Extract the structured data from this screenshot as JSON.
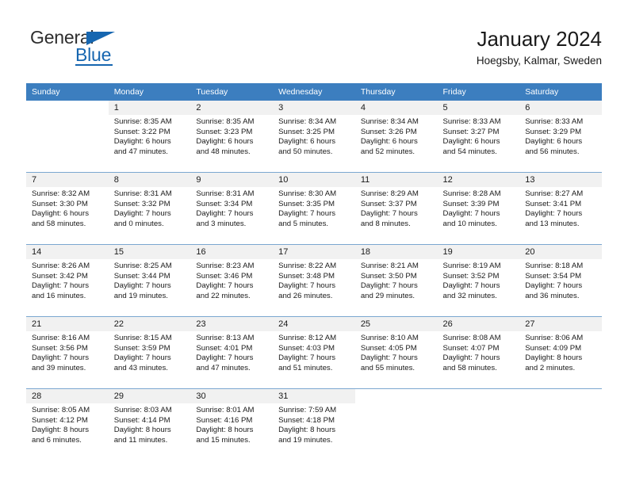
{
  "brand": {
    "name_part1": "General",
    "name_part2": "Blue",
    "accent_color": "#1666b0"
  },
  "header": {
    "title": "January 2024",
    "subtitle": "Hoegsby, Kalmar, Sweden"
  },
  "calendar": {
    "header_bg": "#3c7ebf",
    "daynum_bg": "#f1f1f1",
    "weekday_headers": [
      "Sunday",
      "Monday",
      "Tuesday",
      "Wednesday",
      "Thursday",
      "Friday",
      "Saturday"
    ],
    "weeks": [
      [
        {
          "day": "",
          "lines": []
        },
        {
          "day": "1",
          "lines": [
            "Sunrise: 8:35 AM",
            "Sunset: 3:22 PM",
            "Daylight: 6 hours",
            "and 47 minutes."
          ]
        },
        {
          "day": "2",
          "lines": [
            "Sunrise: 8:35 AM",
            "Sunset: 3:23 PM",
            "Daylight: 6 hours",
            "and 48 minutes."
          ]
        },
        {
          "day": "3",
          "lines": [
            "Sunrise: 8:34 AM",
            "Sunset: 3:25 PM",
            "Daylight: 6 hours",
            "and 50 minutes."
          ]
        },
        {
          "day": "4",
          "lines": [
            "Sunrise: 8:34 AM",
            "Sunset: 3:26 PM",
            "Daylight: 6 hours",
            "and 52 minutes."
          ]
        },
        {
          "day": "5",
          "lines": [
            "Sunrise: 8:33 AM",
            "Sunset: 3:27 PM",
            "Daylight: 6 hours",
            "and 54 minutes."
          ]
        },
        {
          "day": "6",
          "lines": [
            "Sunrise: 8:33 AM",
            "Sunset: 3:29 PM",
            "Daylight: 6 hours",
            "and 56 minutes."
          ]
        }
      ],
      [
        {
          "day": "7",
          "lines": [
            "Sunrise: 8:32 AM",
            "Sunset: 3:30 PM",
            "Daylight: 6 hours",
            "and 58 minutes."
          ]
        },
        {
          "day": "8",
          "lines": [
            "Sunrise: 8:31 AM",
            "Sunset: 3:32 PM",
            "Daylight: 7 hours",
            "and 0 minutes."
          ]
        },
        {
          "day": "9",
          "lines": [
            "Sunrise: 8:31 AM",
            "Sunset: 3:34 PM",
            "Daylight: 7 hours",
            "and 3 minutes."
          ]
        },
        {
          "day": "10",
          "lines": [
            "Sunrise: 8:30 AM",
            "Sunset: 3:35 PM",
            "Daylight: 7 hours",
            "and 5 minutes."
          ]
        },
        {
          "day": "11",
          "lines": [
            "Sunrise: 8:29 AM",
            "Sunset: 3:37 PM",
            "Daylight: 7 hours",
            "and 8 minutes."
          ]
        },
        {
          "day": "12",
          "lines": [
            "Sunrise: 8:28 AM",
            "Sunset: 3:39 PM",
            "Daylight: 7 hours",
            "and 10 minutes."
          ]
        },
        {
          "day": "13",
          "lines": [
            "Sunrise: 8:27 AM",
            "Sunset: 3:41 PM",
            "Daylight: 7 hours",
            "and 13 minutes."
          ]
        }
      ],
      [
        {
          "day": "14",
          "lines": [
            "Sunrise: 8:26 AM",
            "Sunset: 3:42 PM",
            "Daylight: 7 hours",
            "and 16 minutes."
          ]
        },
        {
          "day": "15",
          "lines": [
            "Sunrise: 8:25 AM",
            "Sunset: 3:44 PM",
            "Daylight: 7 hours",
            "and 19 minutes."
          ]
        },
        {
          "day": "16",
          "lines": [
            "Sunrise: 8:23 AM",
            "Sunset: 3:46 PM",
            "Daylight: 7 hours",
            "and 22 minutes."
          ]
        },
        {
          "day": "17",
          "lines": [
            "Sunrise: 8:22 AM",
            "Sunset: 3:48 PM",
            "Daylight: 7 hours",
            "and 26 minutes."
          ]
        },
        {
          "day": "18",
          "lines": [
            "Sunrise: 8:21 AM",
            "Sunset: 3:50 PM",
            "Daylight: 7 hours",
            "and 29 minutes."
          ]
        },
        {
          "day": "19",
          "lines": [
            "Sunrise: 8:19 AM",
            "Sunset: 3:52 PM",
            "Daylight: 7 hours",
            "and 32 minutes."
          ]
        },
        {
          "day": "20",
          "lines": [
            "Sunrise: 8:18 AM",
            "Sunset: 3:54 PM",
            "Daylight: 7 hours",
            "and 36 minutes."
          ]
        }
      ],
      [
        {
          "day": "21",
          "lines": [
            "Sunrise: 8:16 AM",
            "Sunset: 3:56 PM",
            "Daylight: 7 hours",
            "and 39 minutes."
          ]
        },
        {
          "day": "22",
          "lines": [
            "Sunrise: 8:15 AM",
            "Sunset: 3:59 PM",
            "Daylight: 7 hours",
            "and 43 minutes."
          ]
        },
        {
          "day": "23",
          "lines": [
            "Sunrise: 8:13 AM",
            "Sunset: 4:01 PM",
            "Daylight: 7 hours",
            "and 47 minutes."
          ]
        },
        {
          "day": "24",
          "lines": [
            "Sunrise: 8:12 AM",
            "Sunset: 4:03 PM",
            "Daylight: 7 hours",
            "and 51 minutes."
          ]
        },
        {
          "day": "25",
          "lines": [
            "Sunrise: 8:10 AM",
            "Sunset: 4:05 PM",
            "Daylight: 7 hours",
            "and 55 minutes."
          ]
        },
        {
          "day": "26",
          "lines": [
            "Sunrise: 8:08 AM",
            "Sunset: 4:07 PM",
            "Daylight: 7 hours",
            "and 58 minutes."
          ]
        },
        {
          "day": "27",
          "lines": [
            "Sunrise: 8:06 AM",
            "Sunset: 4:09 PM",
            "Daylight: 8 hours",
            "and 2 minutes."
          ]
        }
      ],
      [
        {
          "day": "28",
          "lines": [
            "Sunrise: 8:05 AM",
            "Sunset: 4:12 PM",
            "Daylight: 8 hours",
            "and 6 minutes."
          ]
        },
        {
          "day": "29",
          "lines": [
            "Sunrise: 8:03 AM",
            "Sunset: 4:14 PM",
            "Daylight: 8 hours",
            "and 11 minutes."
          ]
        },
        {
          "day": "30",
          "lines": [
            "Sunrise: 8:01 AM",
            "Sunset: 4:16 PM",
            "Daylight: 8 hours",
            "and 15 minutes."
          ]
        },
        {
          "day": "31",
          "lines": [
            "Sunrise: 7:59 AM",
            "Sunset: 4:18 PM",
            "Daylight: 8 hours",
            "and 19 minutes."
          ]
        },
        {
          "day": "",
          "lines": []
        },
        {
          "day": "",
          "lines": []
        },
        {
          "day": "",
          "lines": []
        }
      ]
    ]
  }
}
